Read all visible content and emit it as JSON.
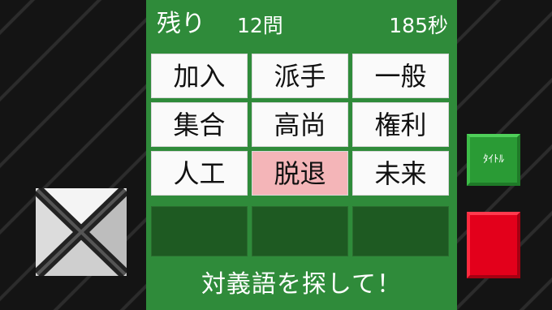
{
  "header": {
    "remaining_label": "残り",
    "remaining_count": "12問",
    "time": "185秒"
  },
  "grid": {
    "rows": [
      [
        "加入",
        "派手",
        "一般"
      ],
      [
        "集合",
        "高尚",
        "権利"
      ],
      [
        "人工",
        "脱退",
        "未来"
      ]
    ],
    "selected": "脱退"
  },
  "footer": {
    "instruction": "対義語を探して！"
  },
  "buttons": {
    "title_label": "ﾀｲﾄﾙ",
    "close_icon": "x-icon",
    "red_icon": "red-square"
  },
  "colors": {
    "panel": "#2f8b3a",
    "selected": "#f4b5b8",
    "red": "#e3001b"
  }
}
